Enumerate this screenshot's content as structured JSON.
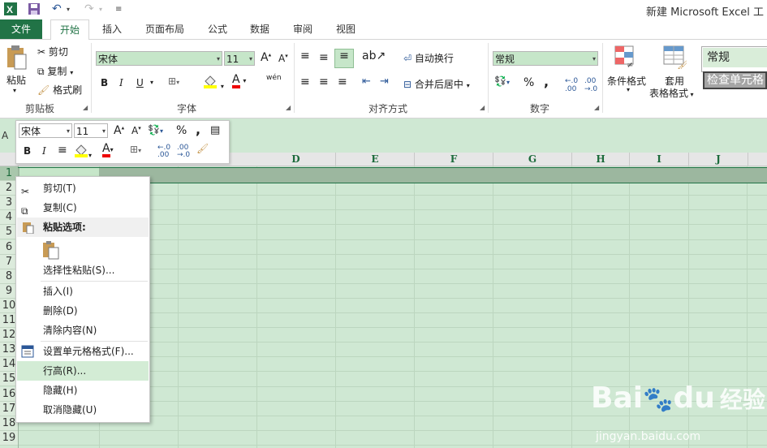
{
  "titlebar": {
    "title": "新建 Microsoft Excel 工"
  },
  "tabs": [
    "文件",
    "开始",
    "插入",
    "页面布局",
    "公式",
    "数据",
    "审阅",
    "视图"
  ],
  "clipboard": {
    "paste": "粘贴",
    "cut": "剪切",
    "copy": "复制",
    "format_painter": "格式刷",
    "group": "剪贴板"
  },
  "font": {
    "name": "宋体",
    "size": "11",
    "group": "字体",
    "bold": "B",
    "italic": "I",
    "underline": "U",
    "grow": "A",
    "shrink": "A",
    "font_color": "A",
    "phonetic": "wén"
  },
  "alignment": {
    "wrap": "自动换行",
    "merge": "合并后居中",
    "group": "对齐方式"
  },
  "number": {
    "format": "常规",
    "percent": "%",
    "comma": ",",
    "group": "数字"
  },
  "styles": {
    "conditional": "条件格式",
    "table_line1": "套用",
    "table_line2": "表格格式",
    "normal": "常规",
    "check_cell": "检查单元格"
  },
  "formula_bar": {
    "namebox": "A"
  },
  "mini_toolbar": {
    "font": "宋体",
    "size": "11",
    "bold": "B",
    "italic": "I",
    "percent": "%",
    "comma": ",",
    "font_color": "A"
  },
  "columns": [
    "D",
    "E",
    "F",
    "G",
    "H",
    "I",
    "J"
  ],
  "rows": [
    "1",
    "2",
    "3",
    "4",
    "5",
    "6",
    "7",
    "8",
    "9",
    "10",
    "11",
    "12",
    "13",
    "14",
    "15",
    "16",
    "17",
    "18",
    "19"
  ],
  "context_menu": {
    "cut": "剪切(T)",
    "copy": "复制(C)",
    "paste_options": "粘贴选项:",
    "paste_special": "选择性粘贴(S)...",
    "insert": "插入(I)",
    "delete": "删除(D)",
    "clear": "清除内容(N)",
    "format_cells": "设置单元格格式(F)...",
    "row_height": "行高(R)...",
    "hide": "隐藏(H)",
    "unhide": "取消隐藏(U)"
  },
  "watermark": {
    "brand": "Bai",
    "brand2": "du",
    "suffix": "经验",
    "url": "jingyan.baidu.com"
  },
  "colors": {
    "accent": "#217346",
    "sheet": "#cfe8d3",
    "selected_row": "#9cb79f"
  }
}
